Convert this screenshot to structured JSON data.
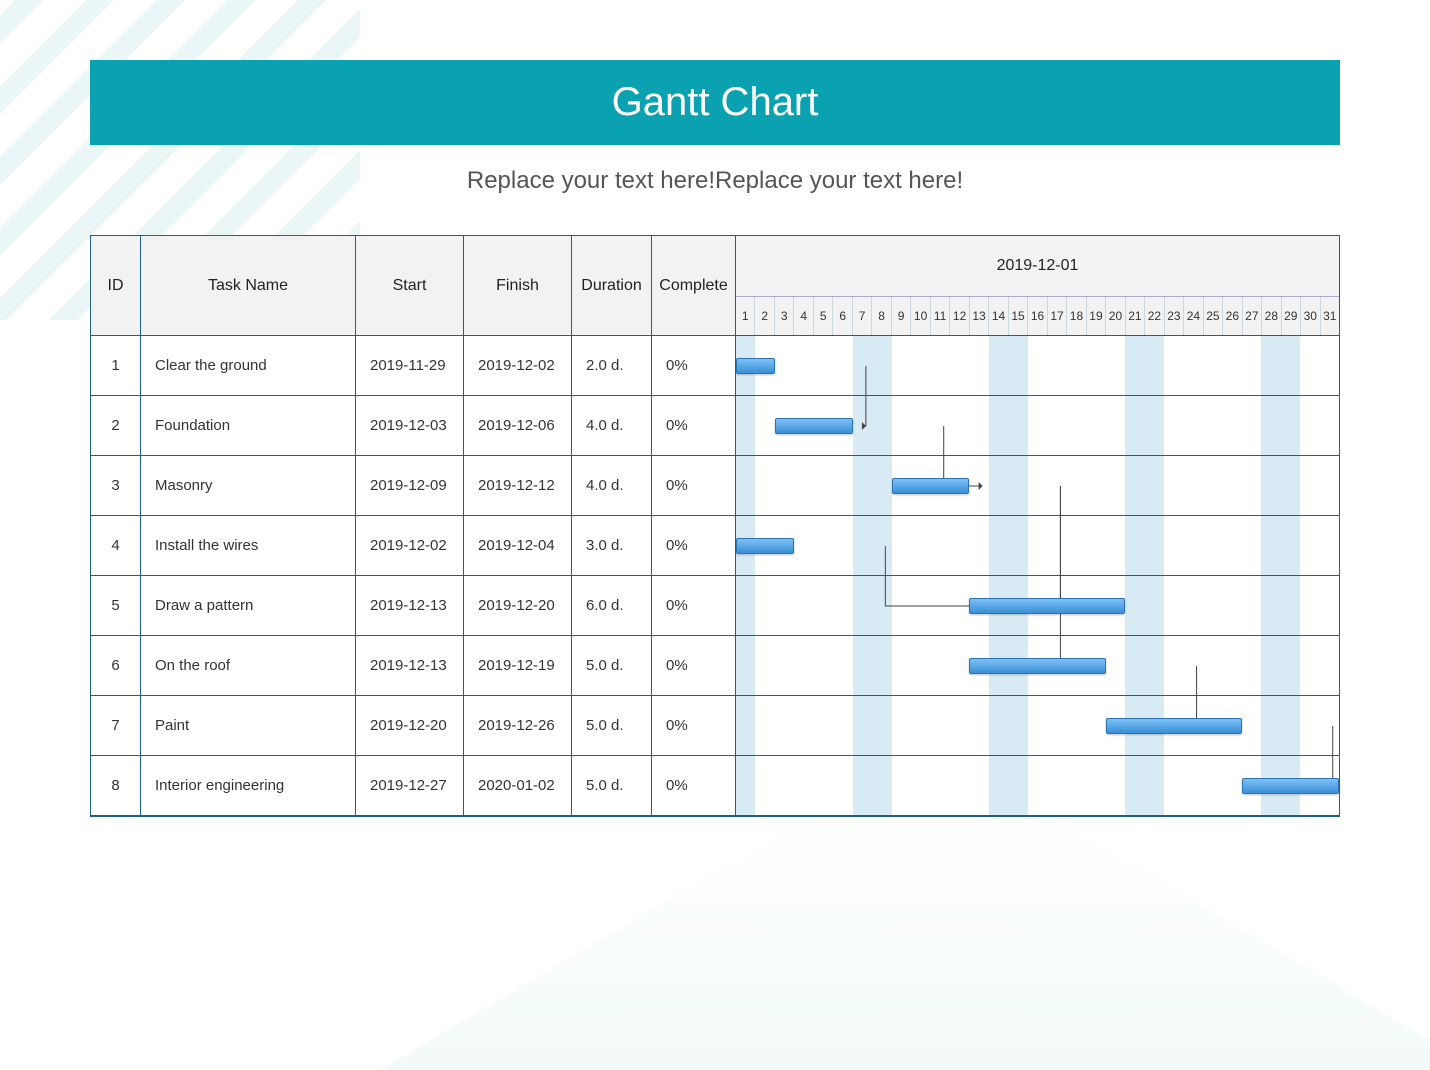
{
  "title": "Gantt Chart",
  "subtitle": "Replace your text here!Replace your text here!",
  "columns": {
    "id": "ID",
    "task": "Task Name",
    "start": "Start",
    "finish": "Finish",
    "duration": "Duration",
    "complete": "Complete"
  },
  "timeline_label": "2019-12-01",
  "days": [
    "1",
    "2",
    "3",
    "4",
    "5",
    "6",
    "7",
    "8",
    "9",
    "10",
    "11",
    "12",
    "13",
    "14",
    "15",
    "16",
    "17",
    "18",
    "19",
    "20",
    "21",
    "22",
    "23",
    "24",
    "25",
    "26",
    "27",
    "28",
    "29",
    "30",
    "31"
  ],
  "shade_days": [
    1,
    7,
    8,
    14,
    15,
    21,
    22,
    28,
    29
  ],
  "tasks": [
    {
      "id": "1",
      "name": "Clear the ground",
      "start": "2019-11-29",
      "finish": "2019-12-02",
      "duration": "2.0 d.",
      "complete": "0%",
      "bar_start": 0,
      "bar_span": 2
    },
    {
      "id": "2",
      "name": "Foundation",
      "start": "2019-12-03",
      "finish": "2019-12-06",
      "duration": "4.0 d.",
      "complete": "0%",
      "bar_start": 2,
      "bar_span": 4
    },
    {
      "id": "3",
      "name": "Masonry",
      "start": "2019-12-09",
      "finish": "2019-12-12",
      "duration": "4.0 d.",
      "complete": "0%",
      "bar_start": 8,
      "bar_span": 4
    },
    {
      "id": "4",
      "name": "Install the wires",
      "start": "2019-12-02",
      "finish": "2019-12-04",
      "duration": "3.0 d.",
      "complete": "0%",
      "bar_start": 0,
      "bar_span": 3
    },
    {
      "id": "5",
      "name": "Draw a pattern",
      "start": "2019-12-13",
      "finish": "2019-12-20",
      "duration": "6.0 d.",
      "complete": "0%",
      "bar_start": 12,
      "bar_span": 8
    },
    {
      "id": "6",
      "name": "On the roof",
      "start": "2019-12-13",
      "finish": "2019-12-19",
      "duration": "5.0 d.",
      "complete": "0%",
      "bar_start": 12,
      "bar_span": 7
    },
    {
      "id": "7",
      "name": "Paint",
      "start": "2019-12-20",
      "finish": "2019-12-26",
      "duration": "5.0 d.",
      "complete": "0%",
      "bar_start": 19,
      "bar_span": 7
    },
    {
      "id": "8",
      "name": "Interior engineering",
      "start": "2019-12-27",
      "finish": "2020-01-02",
      "duration": "5.0 d.",
      "complete": "0%",
      "bar_start": 26,
      "bar_span": 5
    }
  ],
  "dependencies": [
    {
      "from": 0,
      "to": 1
    },
    {
      "from": 1,
      "to": 2
    },
    {
      "from": 2,
      "to": 4
    },
    {
      "from": 2,
      "to": 5
    },
    {
      "from": 3,
      "to": 4
    },
    {
      "from": 5,
      "to": 6
    },
    {
      "from": 6,
      "to": 7
    }
  ],
  "chart_data": {
    "type": "bar",
    "title": "Gantt Chart",
    "xlabel": "2019-12-01",
    "x_range": [
      1,
      31
    ],
    "categories": [
      "Clear the ground",
      "Foundation",
      "Masonry",
      "Install the wires",
      "Draw a pattern",
      "On the roof",
      "Paint",
      "Interior engineering"
    ],
    "series": [
      {
        "name": "Clear the ground",
        "start": "2019-11-29",
        "finish": "2019-12-02",
        "duration_days": 2.0,
        "complete_pct": 0
      },
      {
        "name": "Foundation",
        "start": "2019-12-03",
        "finish": "2019-12-06",
        "duration_days": 4.0,
        "complete_pct": 0
      },
      {
        "name": "Masonry",
        "start": "2019-12-09",
        "finish": "2019-12-12",
        "duration_days": 4.0,
        "complete_pct": 0
      },
      {
        "name": "Install the wires",
        "start": "2019-12-02",
        "finish": "2019-12-04",
        "duration_days": 3.0,
        "complete_pct": 0
      },
      {
        "name": "Draw a pattern",
        "start": "2019-12-13",
        "finish": "2019-12-20",
        "duration_days": 6.0,
        "complete_pct": 0
      },
      {
        "name": "On the roof",
        "start": "2019-12-13",
        "finish": "2019-12-19",
        "duration_days": 5.0,
        "complete_pct": 0
      },
      {
        "name": "Paint",
        "start": "2019-12-20",
        "finish": "2019-12-26",
        "duration_days": 5.0,
        "complete_pct": 0
      },
      {
        "name": "Interior engineering",
        "start": "2019-12-27",
        "finish": "2020-01-02",
        "duration_days": 5.0,
        "complete_pct": 0
      }
    ],
    "dependencies": [
      [
        1,
        2
      ],
      [
        2,
        3
      ],
      [
        3,
        5
      ],
      [
        3,
        6
      ],
      [
        4,
        5
      ],
      [
        6,
        7
      ],
      [
        7,
        8
      ]
    ]
  }
}
